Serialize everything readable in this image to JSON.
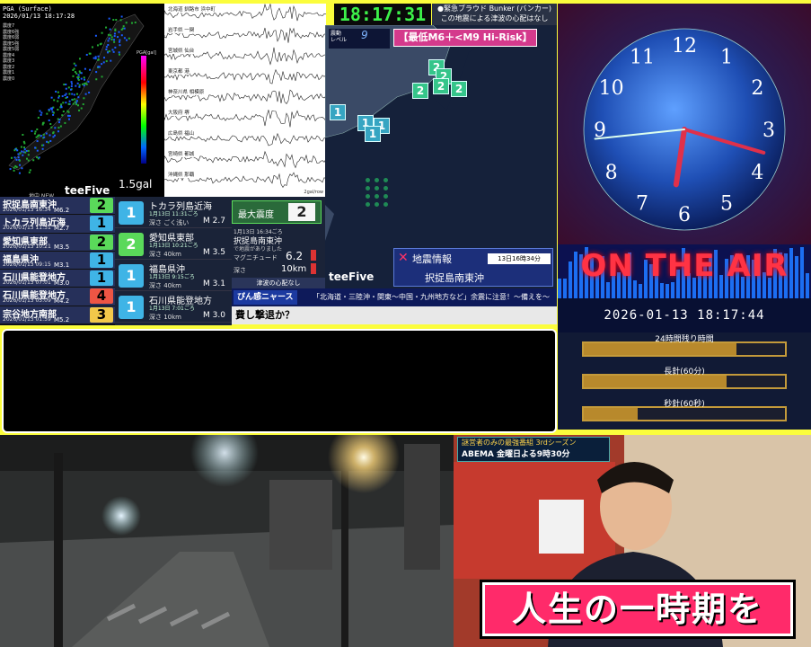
{
  "map_panel": {
    "title": "PGA (Surface)",
    "timestamp": "2026/01/13 18:17:28",
    "scale_title": "PGA[gal]",
    "scale_value": "1.5gal",
    "brand": "teeFive",
    "footer": "地中 NEW",
    "legend": [
      "震度7",
      "震度6強",
      "震度6弱",
      "震度5強",
      "震度5弱",
      "震度4",
      "震度3",
      "震度2",
      "震度1",
      "震度0"
    ]
  },
  "waveform_panel": {
    "stations": [
      "北海道 釧路市 浜中町",
      "岩手県 一関",
      "宮城県 仙台",
      "東京都 港",
      "神奈川県 相模原",
      "大阪府 堺",
      "広島県 福山",
      "宮崎県 都城",
      "沖縄県 那覇"
    ],
    "footer": "2gal/row"
  },
  "quake_list": {
    "header": "最大震度",
    "items": [
      {
        "name": "択捉島南東沖",
        "date": "2026/01/13 16:34",
        "mag": "M6.2",
        "intensity": "2",
        "color": "#5ad95a"
      },
      {
        "name": "トカラ列島近海",
        "date": "2026/01/13 11:31",
        "mag": "M2.7",
        "intensity": "1",
        "color": "#3fb4e6"
      },
      {
        "name": "愛知県東部",
        "date": "2026/01/13 10:21",
        "mag": "M3.5",
        "intensity": "2",
        "color": "#5ad95a"
      },
      {
        "name": "福島県沖",
        "date": "2026/01/13 09:15",
        "mag": "M3.1",
        "intensity": "1",
        "color": "#3fb4e6"
      },
      {
        "name": "石川県能登地方",
        "date": "2026/01/13 07:01",
        "mag": "M3.0",
        "intensity": "1",
        "color": "#3fb4e6"
      },
      {
        "name": "石川県能登地方",
        "date": "2026/01/13 05:09",
        "mag": "M4.2",
        "intensity": "4",
        "color": "#ee5544"
      },
      {
        "name": "宗谷地方南部",
        "date": "2026/01/13 01:59",
        "mag": "M5.2",
        "intensity": "3",
        "color": "#f2c84a"
      }
    ]
  },
  "quake_cards": {
    "header": "最大震度",
    "items": [
      {
        "intensity": "1",
        "name": "トカラ列島近海",
        "time": "1月13日 11:31ごろ",
        "depth": "深さ ごく浅い",
        "mag": "M 2.7",
        "color": "#3fb4e6"
      },
      {
        "intensity": "2",
        "name": "愛知県東部",
        "time": "1月13日 10:21ごろ",
        "depth": "深さ 40km",
        "mag": "M 3.5",
        "color": "#5ad95a"
      },
      {
        "intensity": "1",
        "name": "福島県沖",
        "time": "1月13日 9:15ごろ",
        "depth": "深さ 40km",
        "mag": "M 3.1",
        "color": "#3fb4e6"
      },
      {
        "intensity": "1",
        "name": "石川県能登地方",
        "time": "1月13日 7:01ごろ",
        "depth": "深さ 10km",
        "mag": "M 3.0",
        "color": "#3fb4e6"
      }
    ]
  },
  "detail_panel": {
    "max_label": "最大震度",
    "max_value": "2",
    "time": "1月13日 16:34ごろ",
    "location": "択捉島南東沖",
    "note": "で地震がありました",
    "mag_label": "マグニチュード",
    "mag_value": "6.2",
    "depth_label": "深さ",
    "depth_value": "10km",
    "tsunami": "津波の心配なし"
  },
  "header": {
    "clock": "18:17:31",
    "bunker_line1": "●緊急ブラウド Bunker (バンカー)",
    "bunker_line2": "この地震による津波の心配はなし"
  },
  "japan_map": {
    "level_label": "震動\nレベル",
    "level_value": "9",
    "risk_banner": "【最低M6＋<M9 Hi-Risk】",
    "brand": "teeFive",
    "markers": [
      "2",
      "2",
      "2",
      "2",
      "2",
      "1",
      "1",
      "1",
      "1"
    ]
  },
  "eq_info": {
    "title": "地震情報",
    "time": "13日16時34分",
    "location": "択捉島南東沖"
  },
  "ticker": {
    "channel": "ぴん感ニャース",
    "text": "「北海道・三陸沖・関東〜中国・九州地方など」余震に注意！〜備えを〜"
  },
  "bulletin": {
    "text": "費し撃退か？"
  },
  "analog_clock": {
    "numbers": [
      "12",
      "1",
      "2",
      "3",
      "4",
      "5",
      "6",
      "7",
      "8",
      "9",
      "10",
      "11"
    ],
    "hour": 6,
    "minute": 17,
    "second": 44
  },
  "on_air": {
    "label": "ON THE AIR"
  },
  "datetime": {
    "value": "2026-01-13 18:17:44"
  },
  "timers": [
    {
      "label": "24時間残り時間",
      "fill": 0.76
    },
    {
      "label": "長針(60分)",
      "fill": 0.71
    },
    {
      "label": "秒針(60秒)",
      "fill": 0.27
    }
  ],
  "tv_panel": {
    "show_title": "謎営者のみの最強番組 3rdシーズン",
    "channel": "ABEMA 金曜日よる9時30分",
    "caption": "人生の一時期を"
  }
}
